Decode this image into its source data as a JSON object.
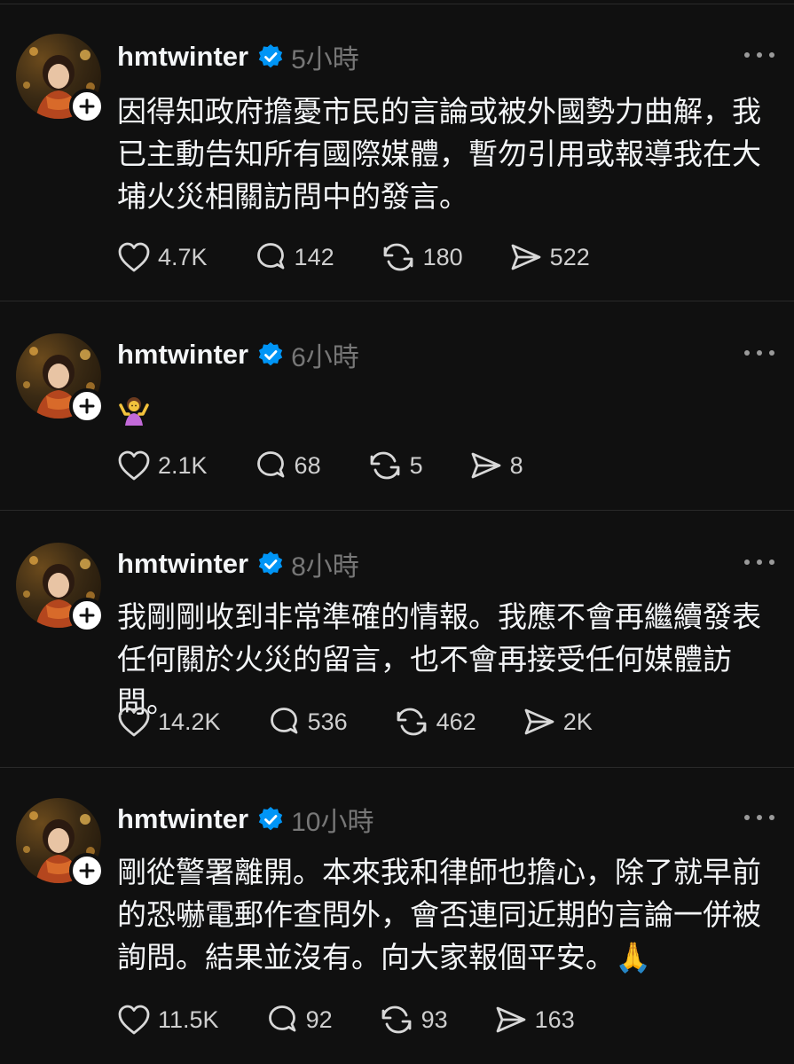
{
  "colors": {
    "background": "#101010",
    "text": "#f3f5f7",
    "muted": "#777777",
    "verified": "#0095f6"
  },
  "posts": [
    {
      "username": "hmtwinter",
      "time": "5小時",
      "text": "因得知政府擔憂市民的言論或被外國勢力曲解，我已主動告知所有國際媒體，暫勿引用或報導我在大埔火災相關訪問中的發言。",
      "likes": "4.7K",
      "comments": "142",
      "reposts": "180",
      "shares": "522"
    },
    {
      "username": "hmtwinter",
      "time": "6小時",
      "text": "",
      "emoji": "person-shrugging-emoji",
      "likes": "2.1K",
      "comments": "68",
      "reposts": "5",
      "shares": "8"
    },
    {
      "username": "hmtwinter",
      "time": "8小時",
      "text": "我剛剛收到非常準確的情報。我應不會再繼續發表任何關於火災的留言，也不會再接受任何媒體訪問。",
      "likes": "14.2K",
      "comments": "536",
      "reposts": "462",
      "shares": "2K"
    },
    {
      "username": "hmtwinter",
      "time": "10小時",
      "text": "剛從警署離開。本來我和律師也擔心，除了就早前的恐嚇電郵作查問外，會否連同近期的言論一併被詢問。結果並沒有。向大家報個平安。🙏",
      "likes": "11.5K",
      "comments": "92",
      "reposts": "93",
      "shares": "163"
    }
  ]
}
